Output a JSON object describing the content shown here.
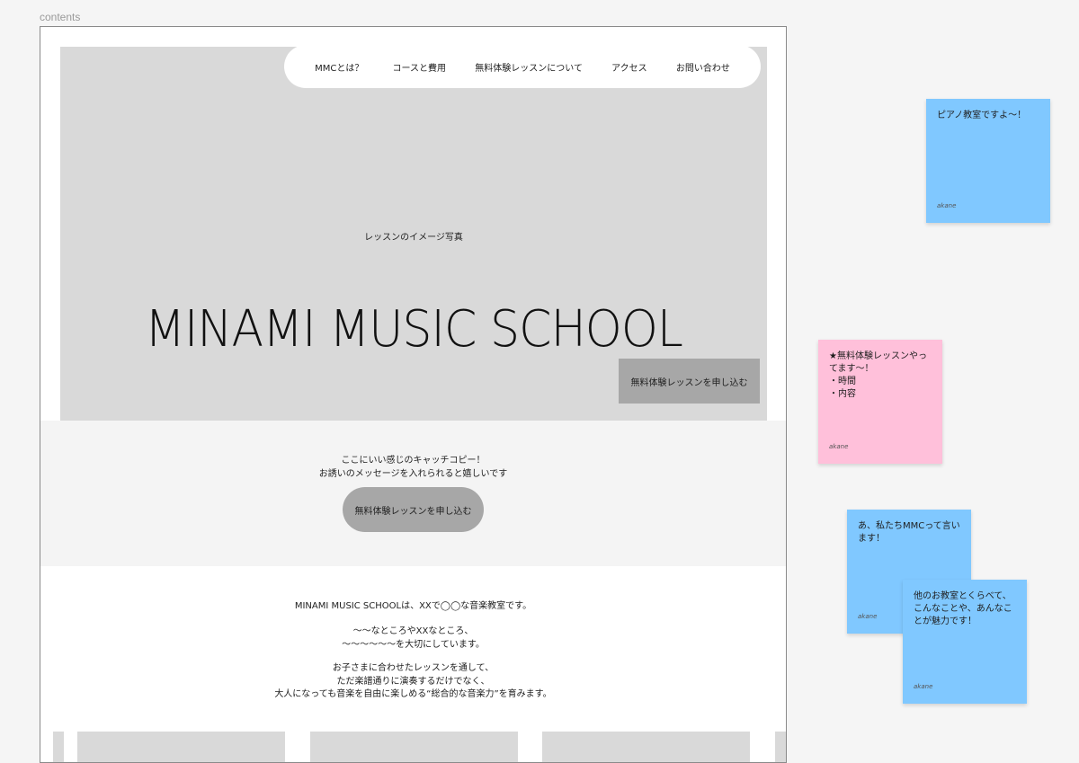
{
  "frame": {
    "label": "contents"
  },
  "nav": {
    "items": [
      {
        "label": "MMCとは？"
      },
      {
        "label": "コースと費用"
      },
      {
        "label": "無料体験レッスンについて"
      },
      {
        "label": "アクセス"
      },
      {
        "label": "お問い合わせ"
      }
    ]
  },
  "hero": {
    "photo_placeholder": "レッスンのイメージ写真",
    "title": "MINAMI MUSIC SCHOOL",
    "cta_label": "無料体験レッスンを申し込む"
  },
  "catch": {
    "line1": "ここにいい感じのキャッチコピー！",
    "line2": "お誘いのメッセージを入れられると嬉しいです",
    "cta_label": "無料体験レッスンを申し込む"
  },
  "about": {
    "p1": "MINAMI MUSIC SCHOOLは、XXで◯◯な音楽教室です。",
    "p2_l1": "〜〜なところやXXなところ、",
    "p2_l2": "〜〜〜〜〜〜を大切にしています。",
    "p3_l1": "お子さまに合わせたレッスンを通して、",
    "p3_l2": "ただ楽譜通りに演奏するだけでなく、",
    "p3_l3": "大人になっても音楽を自由に楽しめる“総合的な音楽力”を育みます。"
  },
  "notes": [
    {
      "text": "ピアノ教室ですよ〜！",
      "author": "akane",
      "color": "#80c8ff"
    },
    {
      "text": "★無料体験レッスンやってます〜！\n・時間\n・内容",
      "author": "akane",
      "color": "#ffc0da"
    },
    {
      "text": "あ、私たちMMCって言います！",
      "author": "akane",
      "color": "#80c8ff"
    },
    {
      "text": "他のお教室とくらべて、こんなことや、あんなことが魅力です！",
      "author": "akane",
      "color": "#80c8ff"
    }
  ]
}
